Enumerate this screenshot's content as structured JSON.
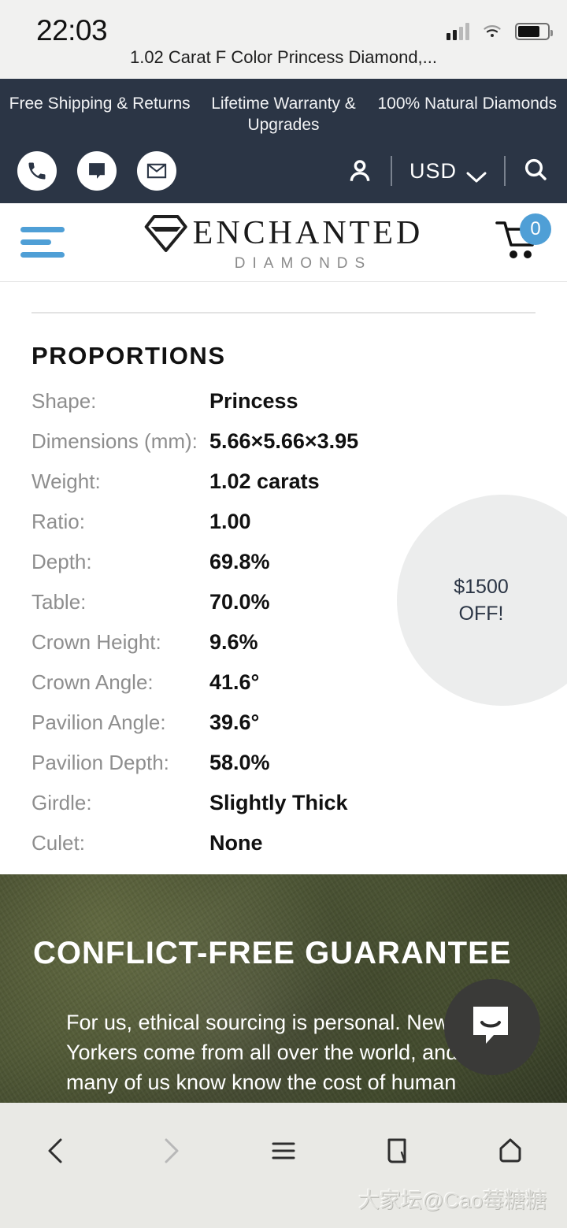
{
  "status_bar": {
    "time": "22:03",
    "page_title": "1.02 Carat F Color Princess Diamond,..."
  },
  "top_bar": {
    "value_props": [
      "Free Shipping & Returns",
      "Lifetime Warranty & Upgrades",
      "100% Natural Diamonds"
    ],
    "contact_icons": [
      "phone-icon",
      "chat-icon",
      "email-icon"
    ],
    "account_icon": "user-icon",
    "currency": "USD",
    "currency_chevron": "chevron-down-icon",
    "search_icon": "search-icon"
  },
  "header": {
    "menu_icon": "hamburger-menu-icon",
    "logo_mark": "diamond-logo-icon",
    "logo_name": "ENCHANTED",
    "logo_subtitle": "DIAMONDS",
    "cart_icon": "shopping-cart-icon",
    "cart_count": "0"
  },
  "main": {
    "section_title": "PROPORTIONS",
    "specs": [
      {
        "label": "Shape:",
        "value": "Princess"
      },
      {
        "label": "Dimensions (mm):",
        "value": "5.66×5.66×3.95"
      },
      {
        "label": "Weight:",
        "value": "1.02 carats"
      },
      {
        "label": "Ratio:",
        "value": "1.00"
      },
      {
        "label": "Depth:",
        "value": "69.8%"
      },
      {
        "label": "Table:",
        "value": "70.0%"
      },
      {
        "label": "Crown Height:",
        "value": "9.6%"
      },
      {
        "label": "Crown Angle:",
        "value": "41.6°"
      },
      {
        "label": "Pavilion Angle:",
        "value": "39.6°"
      },
      {
        "label": "Pavilion Depth:",
        "value": "58.0%"
      },
      {
        "label": "Girdle:",
        "value": "Slightly Thick"
      },
      {
        "label": "Culet:",
        "value": "None"
      }
    ],
    "promo_badge": {
      "line1": "$1500",
      "line2": "OFF!"
    }
  },
  "conflict_free": {
    "title": "CONFLICT-FREE GUARANTEE",
    "body": "For us, ethical sourcing is personal. New Yorkers come from all over the world, and many of us know know the cost of human"
  },
  "chat_widget": {
    "icon": "chat-bubble-icon"
  },
  "browser_nav": {
    "back": "back-arrow-icon",
    "forward": "forward-arrow-icon",
    "menu": "menu-icon",
    "tabs": "tabs-icon",
    "home": "home-icon"
  },
  "watermark": "大家坛@Cao莓糖糖",
  "colors": {
    "topbar_navy": "#2b3545",
    "accent_blue": "#4f9fd6",
    "green_band": "#3b4129"
  }
}
